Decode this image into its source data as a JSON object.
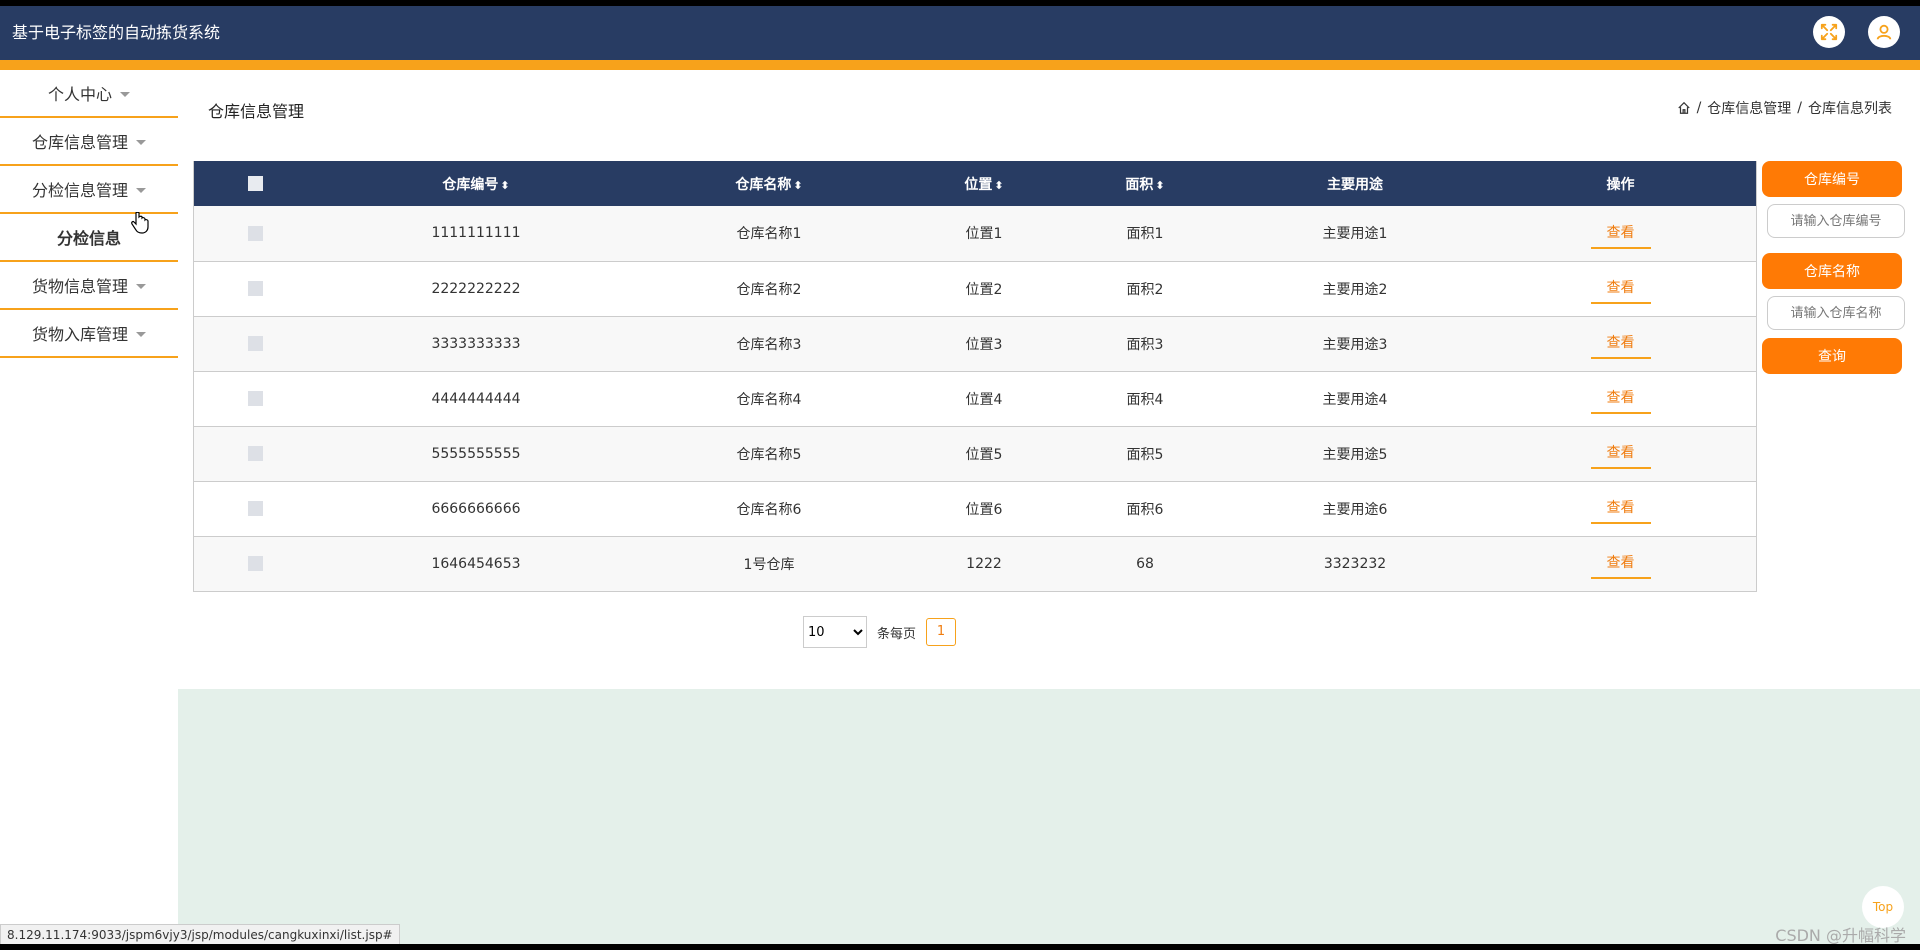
{
  "app": {
    "title": "基于电子标签的自动拣货系统"
  },
  "header_icons": {
    "fullscreen": "fullscreen-icon",
    "user": "user-icon"
  },
  "sidebar": {
    "items": [
      {
        "label": "个人中心",
        "caret": true
      },
      {
        "label": "仓库信息管理",
        "caret": true
      },
      {
        "label": "分检信息管理",
        "caret": true
      },
      {
        "label": "分检信息",
        "caret": false,
        "sub": true
      },
      {
        "label": "货物信息管理",
        "caret": true
      },
      {
        "label": "货物入库管理",
        "caret": true
      }
    ]
  },
  "page": {
    "title": "仓库信息管理"
  },
  "breadcrumb": {
    "sep": "/",
    "items": [
      "仓库信息管理",
      "仓库信息列表"
    ]
  },
  "table": {
    "headers": [
      "仓库编号",
      "仓库名称",
      "位置",
      "面积",
      "主要用途",
      "操作"
    ],
    "sort_glyph": "⬍",
    "action_label": "查看",
    "rows": [
      [
        "1111111111",
        "仓库名称1",
        "位置1",
        "面积1",
        "主要用途1"
      ],
      [
        "2222222222",
        "仓库名称2",
        "位置2",
        "面积2",
        "主要用途2"
      ],
      [
        "3333333333",
        "仓库名称3",
        "位置3",
        "面积3",
        "主要用途3"
      ],
      [
        "4444444444",
        "仓库名称4",
        "位置4",
        "面积4",
        "主要用途4"
      ],
      [
        "5555555555",
        "仓库名称5",
        "位置5",
        "面积5",
        "主要用途5"
      ],
      [
        "6666666666",
        "仓库名称6",
        "位置6",
        "面积6",
        "主要用途6"
      ],
      [
        "1646454653",
        "1号仓库",
        "1222",
        "68",
        "3323232"
      ]
    ]
  },
  "search": {
    "label1": "仓库编号",
    "placeholder1": "请输入仓库编号",
    "label2": "仓库名称",
    "placeholder2": "请输入仓库名称",
    "query_label": "查询"
  },
  "pager": {
    "page_size": "10",
    "per_page_label": "条每页",
    "current_page": "1"
  },
  "top_label": "Top",
  "status_url": "8.129.11.174:9033/jspm6vjy3/jsp/modules/cangkuxinxi/list.jsp#",
  "watermark": "CSDN @升幅科学",
  "colors": {
    "header": "#283c63",
    "accent": "#f7a21b",
    "button": "#ff7a05",
    "footer": "#e4f0ea"
  }
}
